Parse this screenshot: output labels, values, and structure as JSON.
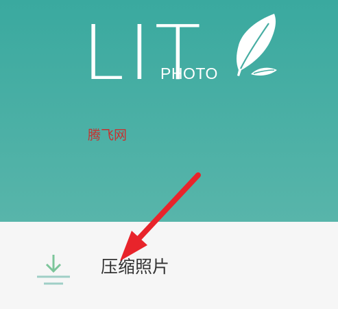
{
  "header": {
    "logo_text": "LIT",
    "logo_subtext": "PHOTO"
  },
  "watermark": "腾飞网",
  "menu": {
    "items": [
      {
        "label": "压缩照片",
        "icon": "download-icon"
      }
    ]
  },
  "colors": {
    "header_top": "#3aa99f",
    "header_bottom": "#58b5aa",
    "panel_background": "#f6f6f6",
    "icon_arrow": "#7cc59a",
    "icon_lines": "#9fcfc6",
    "annotation_arrow": "#e8242b",
    "watermark": "#c8302f"
  },
  "icons": {
    "logo_mark": "feather-icon",
    "annotation": "red-arrow-annotation"
  }
}
